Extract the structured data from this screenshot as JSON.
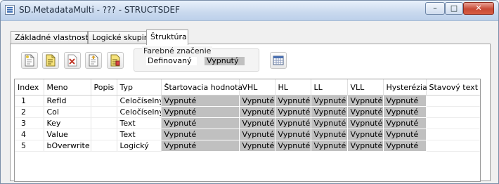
{
  "window": {
    "title": "SD.MetadataMulti - ??? - STRUCTSDEF",
    "controls": {
      "minimize": "–",
      "maximize": "□",
      "close": "✕"
    }
  },
  "tabs": [
    {
      "label": "Základné vlastnosti",
      "active": false
    },
    {
      "label": "Logické skupiny",
      "active": false
    },
    {
      "label": "Štruktúra",
      "active": true
    }
  ],
  "toolbar": {
    "buttons": [
      {
        "name": "new-item-icon"
      },
      {
        "name": "new-item-yellow-icon"
      },
      {
        "name": "delete-item-icon"
      },
      {
        "name": "move-item-icon"
      },
      {
        "name": "edit-item-icon"
      }
    ],
    "grid_button_icon": "grid-table-icon"
  },
  "legend": {
    "title": "Farebné značenie",
    "defined": "Definovaný",
    "off": "Vypnutý",
    "off_color": "#c0c0c0"
  },
  "table": {
    "columns": [
      "Index",
      "Meno",
      "Popis",
      "Typ",
      "Štartovacia hodnota",
      "VHL",
      "HL",
      "LL",
      "VLL",
      "Hysterézia",
      "Stavový text"
    ],
    "rows": [
      {
        "index": "1",
        "meno": "RefId",
        "popis": "",
        "typ": "Celočíselný",
        "start": "Vypnuté",
        "vhl": "Vypnuté",
        "hl": "Vypnuté",
        "ll": "Vypnuté",
        "vll": "Vypnuté",
        "hyst": "Vypnuté",
        "stav": ""
      },
      {
        "index": "2",
        "meno": "Col",
        "popis": "",
        "typ": "Celočíselný",
        "start": "Vypnuté",
        "vhl": "Vypnuté",
        "hl": "Vypnuté",
        "ll": "Vypnuté",
        "vll": "Vypnuté",
        "hyst": "Vypnuté",
        "stav": ""
      },
      {
        "index": "3",
        "meno": "Key",
        "popis": "",
        "typ": "Text",
        "start": "Vypnuté",
        "vhl": "Vypnuté",
        "hl": "Vypnuté",
        "ll": "Vypnuté",
        "vll": "Vypnuté",
        "hyst": "Vypnuté",
        "stav": ""
      },
      {
        "index": "4",
        "meno": "Value",
        "popis": "",
        "typ": "Text",
        "start": "Vypnuté",
        "vhl": "Vypnuté",
        "hl": "Vypnuté",
        "ll": "Vypnuté",
        "vll": "Vypnuté",
        "hyst": "Vypnuté",
        "stav": ""
      },
      {
        "index": "5",
        "meno": "bOverwrite",
        "popis": "",
        "typ": "Logický",
        "start": "Vypnuté",
        "vhl": "Vypnuté",
        "hl": "Vypnuté",
        "ll": "Vypnuté",
        "vll": "Vypnuté",
        "hyst": "Vypnuté",
        "stav": ""
      }
    ]
  }
}
